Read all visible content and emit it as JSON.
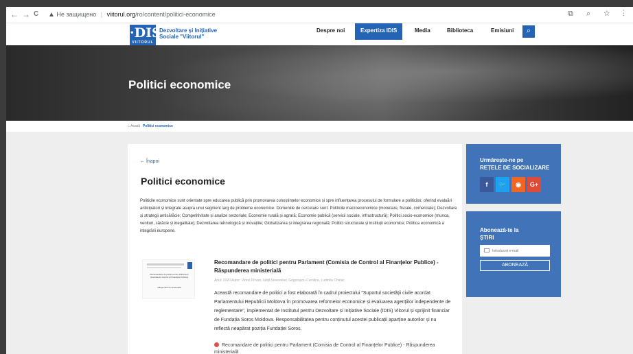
{
  "browser": {
    "nav_back": "←",
    "nav_forward": "→",
    "nav_reload": "C",
    "security_label": "Не защищено",
    "url_domain": "viitorul.org",
    "url_path": "/ro/content/politici-economice",
    "toolbar_icons": "⧉ ⌕ ☆ ⋮"
  },
  "header": {
    "logo_text": "·DIS·",
    "logo_sub": "VIITORUL",
    "brand_line1": "Dezvoltare și Inițiative",
    "brand_line2": "Sociale \"Viitorul\"",
    "menu": {
      "despre": "Despre noi",
      "expertiza": "Expertiza IDIS",
      "media": "Media",
      "biblioteca": "Biblioteca",
      "emisiuni": "Emisiuni"
    },
    "search_icon": "search-icon"
  },
  "hero": {
    "title": "Politici economice"
  },
  "breadcrumb": {
    "home": "⌂ Acasă",
    "current": "Politici economice"
  },
  "main": {
    "back": "← Înapoi",
    "title": "Politici economice",
    "lead": "Politicile economice sunt orientate spre educarea publică prin promovarea cunoștințelor economice și spre influențarea procesului de formulare a politicilor, oferind evaluări anticipatori și integrate asupra unui segment larg de probleme economice. Domeniile de cercetare sunt: Politicile macroeconomice (monetare, fiscale, comerciale); Dezvoltare și strategii antisărăcie; Competitivitate și analize sectoriale; Economie rurală și agrară; Economie publică (servicii sociale, infrastructură); Politici socio-economice (munca, venituri, sărăcie și inegalitate); Dezvoltarea tehnologică și inovațiile; Globalizarea și integrarea regională; Politici structurale și instituții economice; Politica economică a integrării europene.",
    "publication": {
      "thumb_text_1": "Recomandare de politici pentru Parlament (Comisia de Control al Finanțelor Publice)",
      "thumb_text_2": "Răspunderea ministerială",
      "title": "Recomandare de politici pentru Parlament (Comisia de Control al Finanțelor Publice) - Răspunderea ministerială",
      "meta": "Anul: 2020    Autor: Viorel Pîrvan, Iuliță Veaceslav, Grigorașcu Carolina, Ludmila Chiriac",
      "description": "Această recomandare de politici a fost elaborată în cadrul proiectului \"Suportul societății civile acordat Parlamentului Republicii Moldova în promovarea reformelor economice și evaluarea agențiilor independente de reglementare\", implementat de Institutul pentru Dezvoltare și Inițiative Sociale (IDIS) Viitorul și sprijinit financiar de Fundația Soros Moldova. Responsabilitatea pentru conținutul acestei publicații aparține autorilor și nu reflectă neapărat poziția Fundației Soros.",
      "pdf_link": "Recomandare de politici pentru Parlament (Comisia de Control al Finanțelor Publice) - Răspunderea ministerială"
    }
  },
  "sidebar": {
    "social_title_1": "Urmărește-ne pe",
    "social_title_2": "REȚELE DE SOCIALIZARE",
    "social": [
      {
        "label": "f",
        "color": "#3b5998"
      },
      {
        "label": "🐦",
        "color": "#1da1f2"
      },
      {
        "label": "◉",
        "color": "#f26522"
      },
      {
        "label": "G+",
        "color": "#dd4b39"
      }
    ],
    "subscribe_title_1": "Abonează-te la",
    "subscribe_title_2": "ȘTIRI",
    "email_placeholder": "Introduceți e-mail",
    "subscribe_button": "ABONEAZĂ"
  }
}
